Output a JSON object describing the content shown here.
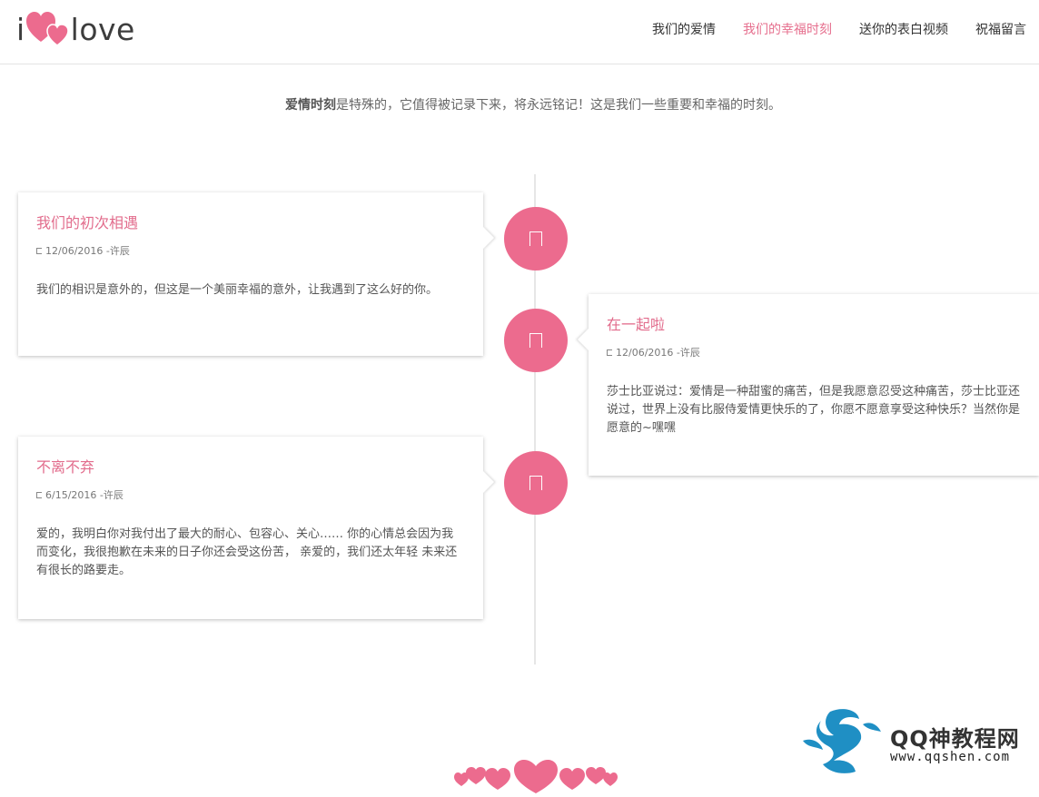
{
  "logo": {
    "i": "i",
    "word": "love"
  },
  "nav": {
    "items": [
      {
        "label": "我们的爱情",
        "active": false
      },
      {
        "label": "我们的幸福时刻",
        "active": true
      },
      {
        "label": "送你的表白视频",
        "active": false
      },
      {
        "label": "祝福留言",
        "active": false
      }
    ]
  },
  "intro": {
    "bold": "爱情时刻",
    "text": "是特殊的，它值得被记录下来，将永远铭记！这是我们一些重要和幸福的时刻。"
  },
  "timeline": [
    {
      "side": "left",
      "title": "我们的初次相遇",
      "meta": "12/06/2016 -许辰",
      "body": "我们的相识是意外的，但这是一个美丽幸福的意外，让我遇到了这么好的你。"
    },
    {
      "side": "right",
      "title": "在一起啦",
      "meta": "12/06/2016 -许辰",
      "body": "莎士比亚说过：爱情是一种甜蜜的痛苦，但是我愿意忍受这种痛苦，莎士比亚还说过，世界上没有比服侍爱情更快乐的了，你愿不愿意享受这种快乐？当然你是愿意的~嘿嘿"
    },
    {
      "side": "left",
      "title": "不离不弃",
      "meta": "6/15/2016 -许辰",
      "body": "爱的，我明白你对我付出了最大的耐心、包容心、关心…… 你的心情总会因为我而变化，我很抱歉在未来的日子你还会受这份苦， 亲爱的，我们还太年轻 未来还有很长的路要走。"
    }
  ],
  "watermark": {
    "title": "QQ神教程网",
    "url": "www.qqshen.com"
  },
  "colors": {
    "accent": "#e66f8e",
    "dot": "#ec6b8e"
  },
  "icons": [
    "heart-logo-icon",
    "calendar-icon",
    "timeline-dot-icon",
    "dragon-icon",
    "hearts-decoration-icon"
  ]
}
